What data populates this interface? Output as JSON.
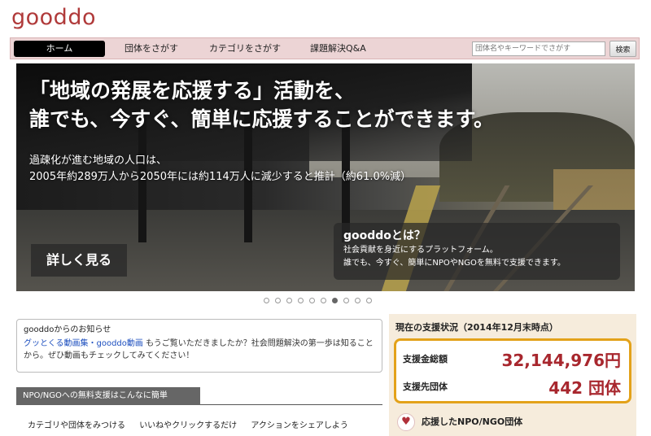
{
  "logo": "gooddo",
  "nav": {
    "home": "ホーム",
    "items": [
      "団体をさがす",
      "カテゴリをさがす",
      "課題解決Q&A"
    ],
    "search_placeholder": "団体名やキーワードでさがす",
    "search_button": "検索"
  },
  "hero": {
    "title_line1": "「地域の発展を応援する」活動を、",
    "title_line2": "誰でも、今すぐ、簡単に応援することができます。",
    "sub_line1": "過疎化が進む地域の人口は、",
    "sub_line2": "2005年約289万人から2050年には約114万人に減少すると推計（約61.0%減）",
    "details_button": "詳しく見る",
    "about_title": "gooddoとは？",
    "about_line1": "社会貢献を身近にするプラットフォーム。",
    "about_line2": "誰でも、今すぐ、簡単にNPOやNGOを無料で支援できます。"
  },
  "carousel": {
    "count": 10,
    "active_index": 6
  },
  "news": {
    "title": "gooddoからのお知らせ",
    "link": "グッとくる動画集・gooddo動画",
    "body": " もうご覧いただきましたか？社会問題解決の第一歩は知ることから。ぜひ動画もチェックしてみてください！"
  },
  "section": {
    "title": "NPO/NGOへの無料支援はこんなに簡単",
    "steps": [
      "カテゴリや団体をみつける",
      "いいねやクリックするだけ",
      "アクションをシェアしよう"
    ]
  },
  "status": {
    "title": "現在の支援状況（2014年12月末時点）",
    "amount_label": "支援金総額",
    "amount_value": "32,144,976円",
    "orgs_label": "支援先団体",
    "orgs_value": "442 団体",
    "supported_label": "応援したNPO/NGO団体"
  },
  "colors": {
    "brand": "#b03a3a",
    "nav_bg": "#ecd4d5",
    "highlight": "#e3a21a",
    "value": "#a8272e"
  }
}
